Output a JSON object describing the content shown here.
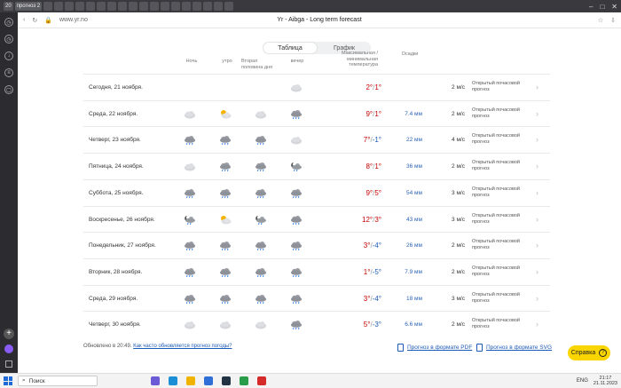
{
  "browser": {
    "active_tab": "прогноз 2",
    "address": "www.yr.no",
    "page_title": "Yr - Aibga - Long term forecast"
  },
  "view_toggle": {
    "table": "Таблица",
    "graph": "График"
  },
  "columns": {
    "night": "Ночь",
    "morning": "утро",
    "afternoon": "Вторая половина дня",
    "evening": "вечер",
    "temp": "Максимальная / минимальная температура",
    "precip": "Осадки"
  },
  "rows": [
    {
      "date": "Сегодня, 21 ноября.",
      "icons": [
        "",
        "",
        "",
        "cloud-light"
      ],
      "hi": "2°",
      "lo": "1°",
      "lo_neg": false,
      "precip": "",
      "wind": "2 м/с",
      "link": "Открытый почасовой прогноз"
    },
    {
      "date": "Среда, 22 ноября.",
      "icons": [
        "cloud-light",
        "sun-cloud",
        "cloud-light",
        "cloud-rain"
      ],
      "hi": "9°",
      "lo": "1°",
      "lo_neg": false,
      "precip": "7.4 мм",
      "wind": "2 м/с",
      "link": "Открытый почасовой прогноз"
    },
    {
      "date": "Четверг, 23 ноября.",
      "icons": [
        "cloud-rain",
        "cloud-rain",
        "cloud-rain",
        "cloud-light"
      ],
      "hi": "7°",
      "lo": "-1°",
      "lo_neg": true,
      "precip": "22 мм",
      "wind": "4 м/с",
      "link": "Открытый почасовой прогноз"
    },
    {
      "date": "Пятница, 24 ноября.",
      "icons": [
        "cloud-light",
        "cloud-rain",
        "cloud-rain",
        "moon-cloud-rain"
      ],
      "hi": "8°",
      "lo": "1°",
      "lo_neg": false,
      "precip": "36 мм",
      "wind": "2 м/с",
      "link": "Открытый почасовой прогноз"
    },
    {
      "date": "Суббота, 25 ноября.",
      "icons": [
        "cloud-rain",
        "cloud-rain",
        "cloud-rain",
        "cloud-rain"
      ],
      "hi": "9°",
      "lo": "5°",
      "lo_neg": false,
      "precip": "54 мм",
      "wind": "3 м/с",
      "link": "Открытый почасовой прогноз"
    },
    {
      "date": "Воскресенье, 26 ноября.",
      "icons": [
        "moon-cloud-rain",
        "sun-cloud",
        "moon-cloud-rain",
        "cloud-rain"
      ],
      "hi": "12°",
      "lo": "3°",
      "lo_neg": false,
      "precip": "43 мм",
      "wind": "3 м/с",
      "link": "Открытый почасовой прогноз"
    },
    {
      "date": "Понедельник, 27 ноября.",
      "icons": [
        "cloud-rain",
        "cloud-rain",
        "cloud-rain",
        "cloud-rain"
      ],
      "hi": "3°",
      "lo": "-4°",
      "lo_neg": true,
      "precip": "26 мм",
      "wind": "2 м/с",
      "link": "Открытый почасовой прогноз"
    },
    {
      "date": "Вторник, 28 ноября.",
      "icons": [
        "cloud-rain",
        "cloud-rain",
        "cloud-rain",
        "cloud-rain"
      ],
      "hi": "1°",
      "lo": "-5°",
      "lo_neg": true,
      "precip": "7.9 мм",
      "wind": "2 м/с",
      "link": "Открытый почасовой прогноз"
    },
    {
      "date": "Среда, 29 ноября.",
      "icons": [
        "cloud-rain",
        "cloud-rain",
        "cloud-rain",
        "cloud-rain"
      ],
      "hi": "3°",
      "lo": "-4°",
      "lo_neg": true,
      "precip": "18 мм",
      "wind": "3 м/с",
      "link": "Открытый почасовой прогноз"
    },
    {
      "date": "Четверг, 30 ноября.",
      "icons": [
        "cloud-light",
        "cloud-light",
        "cloud-light",
        "cloud-rain"
      ],
      "hi": "5°",
      "lo": "-3°",
      "lo_neg": true,
      "precip": "6.6 мм",
      "wind": "2 м/с",
      "link": "Открытый почасовой прогноз"
    }
  ],
  "footer": {
    "updated": "Обновлено в 20:49.",
    "how_often": "Как часто обновляется прогноз погоды?",
    "pdf": "Прогноз в формате PDF",
    "svg": "Прогноз в формате SVG",
    "help": "Справка"
  },
  "taskbar": {
    "search": "Поиск",
    "lang": "ENG",
    "time": "21:17",
    "date": "21.11.2023"
  },
  "colors": {
    "temp_pos": "#c60000",
    "temp_neg": "#1d5bb8",
    "link": "#1d5bb8",
    "help_bg": "#fbd500"
  }
}
